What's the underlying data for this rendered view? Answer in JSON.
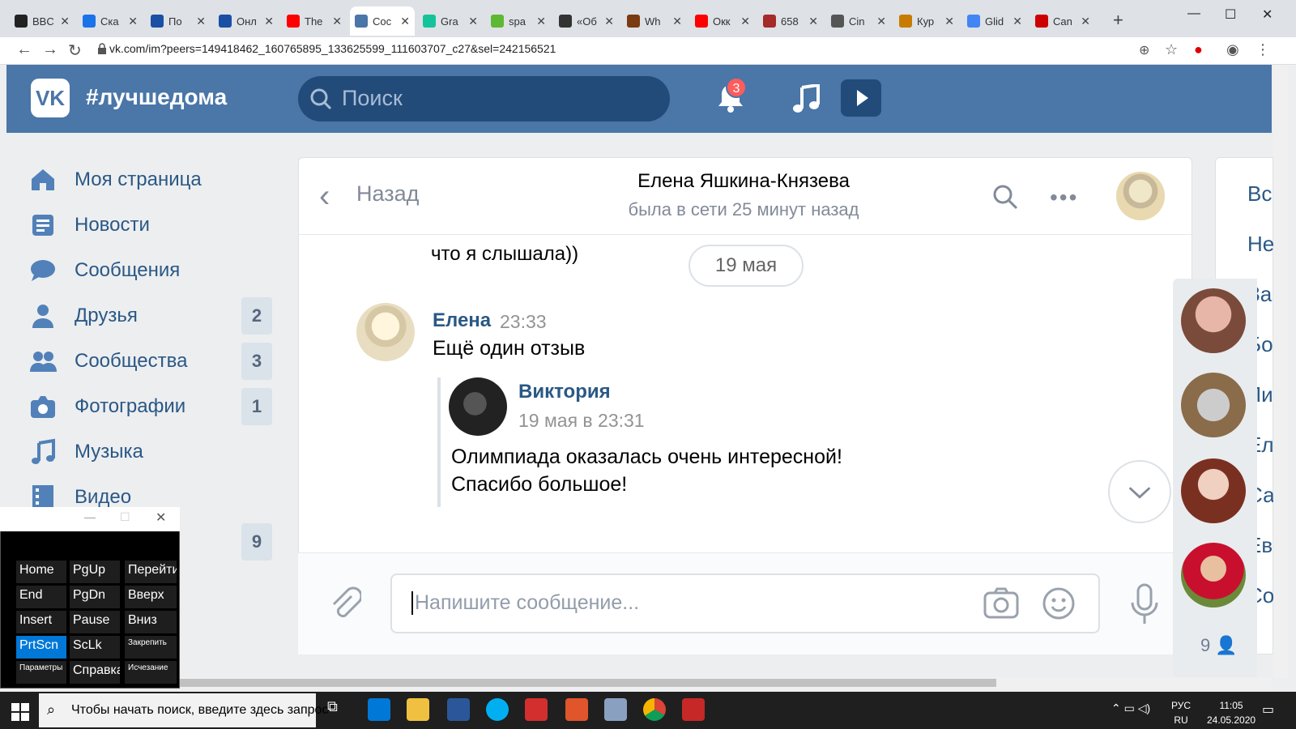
{
  "browser": {
    "tabs": [
      {
        "label": "BBC",
        "color": "#222"
      },
      {
        "label": "Ска",
        "color": "#1a73e8"
      },
      {
        "label": "По",
        "color": "#1a4fa3"
      },
      {
        "label": "Онл",
        "color": "#1a4fa3"
      },
      {
        "label": "The",
        "color": "#ff0000"
      },
      {
        "label": "Сос",
        "color": "#4a76a8",
        "active": true
      },
      {
        "label": "Gra",
        "color": "#15c39a"
      },
      {
        "label": "spa",
        "color": "#5fb832"
      },
      {
        "label": "«Об",
        "color": "#333"
      },
      {
        "label": "Wh",
        "color": "#7a3b10"
      },
      {
        "label": "Окк",
        "color": "#ff0000"
      },
      {
        "label": "658",
        "color": "#a52a2a"
      },
      {
        "label": "Cin",
        "color": "#555"
      },
      {
        "label": "Кур",
        "color": "#c77b00"
      },
      {
        "label": "Glid",
        "color": "#4285f4"
      },
      {
        "label": "Can",
        "color": "#cc0000"
      }
    ],
    "url": "vk.com/im?peers=149418462_160765895_133625599_111603707_c27&sel=242156521"
  },
  "vk": {
    "title": "#лучшедома",
    "search_placeholder": "Поиск",
    "notifications_count": "3"
  },
  "nav": [
    {
      "label": "Моя страница",
      "icon": "home-icon"
    },
    {
      "label": "Новости",
      "icon": "news-icon"
    },
    {
      "label": "Сообщения",
      "icon": "messages-icon"
    },
    {
      "label": "Друзья",
      "icon": "friends-icon",
      "count": "2"
    },
    {
      "label": "Сообщества",
      "icon": "groups-icon",
      "count": "3"
    },
    {
      "label": "Фотографии",
      "icon": "camera-icon",
      "count": "1"
    },
    {
      "label": "Музыка",
      "icon": "music-icon"
    },
    {
      "label": "Видео",
      "icon": "video-icon"
    }
  ],
  "nav_extra_count": "9",
  "chat": {
    "back": "Назад",
    "name": "Елена Яшкина-Князева",
    "status": "была в сети 25 минут назад",
    "prev_tail": "что я слышала))",
    "date_pill": "19 мая",
    "message": {
      "author": "Елена",
      "time": "23:33",
      "text": "Ещё один отзыв",
      "forward": {
        "author": "Виктория",
        "date": "19 мая в 23:31",
        "line1": "Олимпиада оказалась очень интересной!",
        "line2": "Спасибо большое!"
      }
    },
    "input_placeholder": "Напишите сообщение..."
  },
  "right_letters": [
    "Вс",
    "Не",
    "За",
    "Бо",
    "Ли",
    "Ел",
    "Са",
    "Ев",
    "Со"
  ],
  "friends_count": "9",
  "osk": {
    "keys": [
      [
        "Home",
        "PgUp",
        "Перейти"
      ],
      [
        "End",
        "PgDn",
        "Вверх"
      ],
      [
        "Insert",
        "Pause",
        "Вниз"
      ],
      [
        "PrtScn",
        "ScLk",
        "Закрепить"
      ],
      [
        "Параметры",
        "Справка",
        "Исчезание"
      ]
    ]
  },
  "taskbar": {
    "search_placeholder": "Чтобы начать поиск, введите здесь запрос",
    "lang_top": "РУС",
    "lang_bottom": "RU",
    "time": "11:05",
    "date": "24.05.2020"
  }
}
